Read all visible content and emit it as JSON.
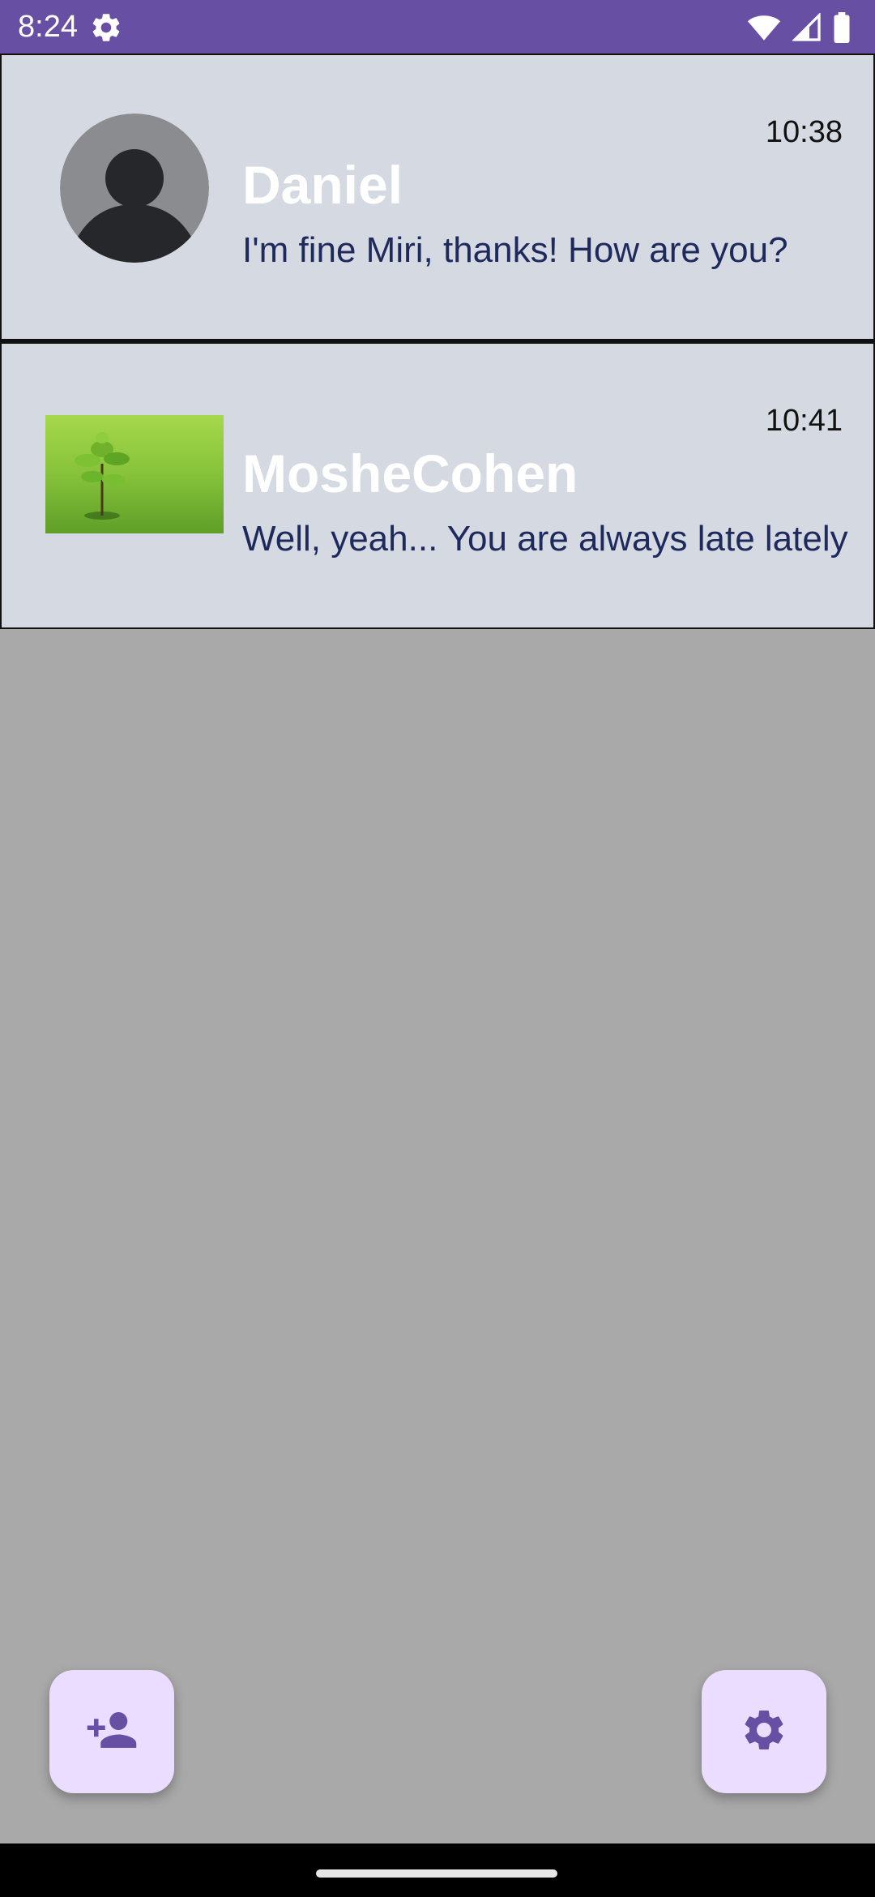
{
  "status_bar": {
    "time": "8:24",
    "icons": [
      "gear-icon",
      "wifi-icon",
      "signal-icon",
      "battery-icon"
    ],
    "background": "#6750a4"
  },
  "chats": [
    {
      "name": "Daniel",
      "time": "10:38",
      "preview": "I'm fine Miri, thanks! How are you?",
      "avatar": "default-person-avatar"
    },
    {
      "name": "MosheCohen",
      "time": "10:41",
      "preview": "Well, yeah... You are always late lately",
      "avatar": "sapling-photo"
    }
  ],
  "fabs": {
    "add_contact_icon": "person-add-icon",
    "settings_icon": "settings-gear-icon"
  },
  "colors": {
    "chat_background": "#d5dae2",
    "screen_background": "#a9a9a9",
    "fab_background": "#eaddff",
    "fab_icon": "#6750a4",
    "name_color": "#ffffff",
    "preview_color": "#1f2a5c"
  }
}
